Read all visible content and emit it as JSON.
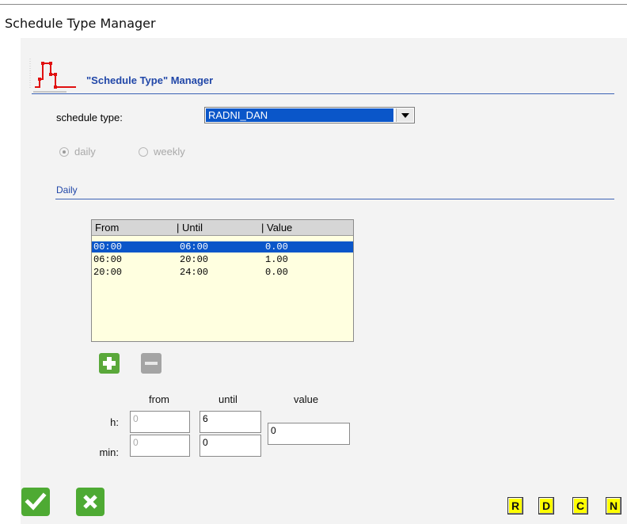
{
  "window": {
    "title": "Schedule Type Manager"
  },
  "header": {
    "title": "\"Schedule Type\" Manager"
  },
  "schedule_type": {
    "label": "schedule type:",
    "selected": "RADNI_DAN"
  },
  "mode": {
    "options": [
      {
        "label": "daily",
        "checked": true
      },
      {
        "label": "weekly",
        "checked": false
      }
    ]
  },
  "section": {
    "label": "Daily"
  },
  "table": {
    "columns": [
      "From",
      "| Until",
      "| Value"
    ],
    "rows": [
      {
        "from": "00:00",
        "until": "06:00",
        "value": "0.00",
        "selected": true
      },
      {
        "from": "06:00",
        "until": "20:00",
        "value": "1.00",
        "selected": false
      },
      {
        "from": "20:00",
        "until": "24:00",
        "value": "0.00",
        "selected": false
      }
    ]
  },
  "editor": {
    "col_from": "from",
    "col_until": "until",
    "col_value": "value",
    "row_h": "h:",
    "row_min": "min:",
    "from_h": "0",
    "from_min": "0",
    "until_h": "6",
    "until_min": "0",
    "value": "0"
  },
  "toolbar_letters": [
    "R",
    "D",
    "C",
    "N"
  ],
  "colors": {
    "accent": "#2147a8",
    "selection": "#0a56c9",
    "table_bg": "#ffffe0",
    "ok_green": "#4eaa33",
    "letter_bg": "#ffff00"
  }
}
